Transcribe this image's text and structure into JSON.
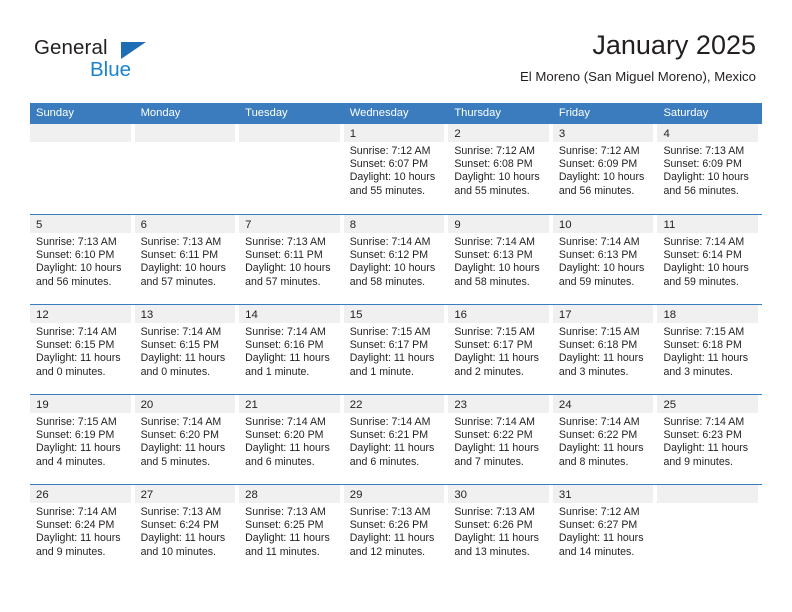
{
  "logo": {
    "word_one": "General",
    "word_two": "Blue",
    "triangle_color": "#1f6eb5",
    "blue_text_color": "#1b84cf"
  },
  "header": {
    "title": "January 2025",
    "subtitle": "El Moreno (San Miguel Moreno), Mexico"
  },
  "theme": {
    "header_row_bg": "#3a7cbe",
    "header_row_text": "#ffffff",
    "daynum_band_bg": "#f0f0f0",
    "separator": "#3a7cbe",
    "body_text": "#231f20"
  },
  "calendar": {
    "weekdays": [
      "Sunday",
      "Monday",
      "Tuesday",
      "Wednesday",
      "Thursday",
      "Friday",
      "Saturday"
    ],
    "labels": {
      "sunrise_prefix": "Sunrise:",
      "sunset_prefix": "Sunset:",
      "daylight_prefix": "Daylight:"
    },
    "weeks": [
      [
        {
          "day": "",
          "sunrise": "",
          "sunset": "",
          "daylight_line1": "",
          "daylight_line2": ""
        },
        {
          "day": "",
          "sunrise": "",
          "sunset": "",
          "daylight_line1": "",
          "daylight_line2": ""
        },
        {
          "day": "",
          "sunrise": "",
          "sunset": "",
          "daylight_line1": "",
          "daylight_line2": ""
        },
        {
          "day": "1",
          "sunrise": "Sunrise: 7:12 AM",
          "sunset": "Sunset: 6:07 PM",
          "daylight_line1": "Daylight: 10 hours",
          "daylight_line2": "and 55 minutes."
        },
        {
          "day": "2",
          "sunrise": "Sunrise: 7:12 AM",
          "sunset": "Sunset: 6:08 PM",
          "daylight_line1": "Daylight: 10 hours",
          "daylight_line2": "and 55 minutes."
        },
        {
          "day": "3",
          "sunrise": "Sunrise: 7:12 AM",
          "sunset": "Sunset: 6:09 PM",
          "daylight_line1": "Daylight: 10 hours",
          "daylight_line2": "and 56 minutes."
        },
        {
          "day": "4",
          "sunrise": "Sunrise: 7:13 AM",
          "sunset": "Sunset: 6:09 PM",
          "daylight_line1": "Daylight: 10 hours",
          "daylight_line2": "and 56 minutes."
        }
      ],
      [
        {
          "day": "5",
          "sunrise": "Sunrise: 7:13 AM",
          "sunset": "Sunset: 6:10 PM",
          "daylight_line1": "Daylight: 10 hours",
          "daylight_line2": "and 56 minutes."
        },
        {
          "day": "6",
          "sunrise": "Sunrise: 7:13 AM",
          "sunset": "Sunset: 6:11 PM",
          "daylight_line1": "Daylight: 10 hours",
          "daylight_line2": "and 57 minutes."
        },
        {
          "day": "7",
          "sunrise": "Sunrise: 7:13 AM",
          "sunset": "Sunset: 6:11 PM",
          "daylight_line1": "Daylight: 10 hours",
          "daylight_line2": "and 57 minutes."
        },
        {
          "day": "8",
          "sunrise": "Sunrise: 7:14 AM",
          "sunset": "Sunset: 6:12 PM",
          "daylight_line1": "Daylight: 10 hours",
          "daylight_line2": "and 58 minutes."
        },
        {
          "day": "9",
          "sunrise": "Sunrise: 7:14 AM",
          "sunset": "Sunset: 6:13 PM",
          "daylight_line1": "Daylight: 10 hours",
          "daylight_line2": "and 58 minutes."
        },
        {
          "day": "10",
          "sunrise": "Sunrise: 7:14 AM",
          "sunset": "Sunset: 6:13 PM",
          "daylight_line1": "Daylight: 10 hours",
          "daylight_line2": "and 59 minutes."
        },
        {
          "day": "11",
          "sunrise": "Sunrise: 7:14 AM",
          "sunset": "Sunset: 6:14 PM",
          "daylight_line1": "Daylight: 10 hours",
          "daylight_line2": "and 59 minutes."
        }
      ],
      [
        {
          "day": "12",
          "sunrise": "Sunrise: 7:14 AM",
          "sunset": "Sunset: 6:15 PM",
          "daylight_line1": "Daylight: 11 hours",
          "daylight_line2": "and 0 minutes."
        },
        {
          "day": "13",
          "sunrise": "Sunrise: 7:14 AM",
          "sunset": "Sunset: 6:15 PM",
          "daylight_line1": "Daylight: 11 hours",
          "daylight_line2": "and 0 minutes."
        },
        {
          "day": "14",
          "sunrise": "Sunrise: 7:14 AM",
          "sunset": "Sunset: 6:16 PM",
          "daylight_line1": "Daylight: 11 hours",
          "daylight_line2": "and 1 minute."
        },
        {
          "day": "15",
          "sunrise": "Sunrise: 7:15 AM",
          "sunset": "Sunset: 6:17 PM",
          "daylight_line1": "Daylight: 11 hours",
          "daylight_line2": "and 1 minute."
        },
        {
          "day": "16",
          "sunrise": "Sunrise: 7:15 AM",
          "sunset": "Sunset: 6:17 PM",
          "daylight_line1": "Daylight: 11 hours",
          "daylight_line2": "and 2 minutes."
        },
        {
          "day": "17",
          "sunrise": "Sunrise: 7:15 AM",
          "sunset": "Sunset: 6:18 PM",
          "daylight_line1": "Daylight: 11 hours",
          "daylight_line2": "and 3 minutes."
        },
        {
          "day": "18",
          "sunrise": "Sunrise: 7:15 AM",
          "sunset": "Sunset: 6:18 PM",
          "daylight_line1": "Daylight: 11 hours",
          "daylight_line2": "and 3 minutes."
        }
      ],
      [
        {
          "day": "19",
          "sunrise": "Sunrise: 7:15 AM",
          "sunset": "Sunset: 6:19 PM",
          "daylight_line1": "Daylight: 11 hours",
          "daylight_line2": "and 4 minutes."
        },
        {
          "day": "20",
          "sunrise": "Sunrise: 7:14 AM",
          "sunset": "Sunset: 6:20 PM",
          "daylight_line1": "Daylight: 11 hours",
          "daylight_line2": "and 5 minutes."
        },
        {
          "day": "21",
          "sunrise": "Sunrise: 7:14 AM",
          "sunset": "Sunset: 6:20 PM",
          "daylight_line1": "Daylight: 11 hours",
          "daylight_line2": "and 6 minutes."
        },
        {
          "day": "22",
          "sunrise": "Sunrise: 7:14 AM",
          "sunset": "Sunset: 6:21 PM",
          "daylight_line1": "Daylight: 11 hours",
          "daylight_line2": "and 6 minutes."
        },
        {
          "day": "23",
          "sunrise": "Sunrise: 7:14 AM",
          "sunset": "Sunset: 6:22 PM",
          "daylight_line1": "Daylight: 11 hours",
          "daylight_line2": "and 7 minutes."
        },
        {
          "day": "24",
          "sunrise": "Sunrise: 7:14 AM",
          "sunset": "Sunset: 6:22 PM",
          "daylight_line1": "Daylight: 11 hours",
          "daylight_line2": "and 8 minutes."
        },
        {
          "day": "25",
          "sunrise": "Sunrise: 7:14 AM",
          "sunset": "Sunset: 6:23 PM",
          "daylight_line1": "Daylight: 11 hours",
          "daylight_line2": "and 9 minutes."
        }
      ],
      [
        {
          "day": "26",
          "sunrise": "Sunrise: 7:14 AM",
          "sunset": "Sunset: 6:24 PM",
          "daylight_line1": "Daylight: 11 hours",
          "daylight_line2": "and 9 minutes."
        },
        {
          "day": "27",
          "sunrise": "Sunrise: 7:13 AM",
          "sunset": "Sunset: 6:24 PM",
          "daylight_line1": "Daylight: 11 hours",
          "daylight_line2": "and 10 minutes."
        },
        {
          "day": "28",
          "sunrise": "Sunrise: 7:13 AM",
          "sunset": "Sunset: 6:25 PM",
          "daylight_line1": "Daylight: 11 hours",
          "daylight_line2": "and 11 minutes."
        },
        {
          "day": "29",
          "sunrise": "Sunrise: 7:13 AM",
          "sunset": "Sunset: 6:26 PM",
          "daylight_line1": "Daylight: 11 hours",
          "daylight_line2": "and 12 minutes."
        },
        {
          "day": "30",
          "sunrise": "Sunrise: 7:13 AM",
          "sunset": "Sunset: 6:26 PM",
          "daylight_line1": "Daylight: 11 hours",
          "daylight_line2": "and 13 minutes."
        },
        {
          "day": "31",
          "sunrise": "Sunrise: 7:12 AM",
          "sunset": "Sunset: 6:27 PM",
          "daylight_line1": "Daylight: 11 hours",
          "daylight_line2": "and 14 minutes."
        },
        {
          "day": "",
          "sunrise": "",
          "sunset": "",
          "daylight_line1": "",
          "daylight_line2": ""
        }
      ]
    ]
  }
}
